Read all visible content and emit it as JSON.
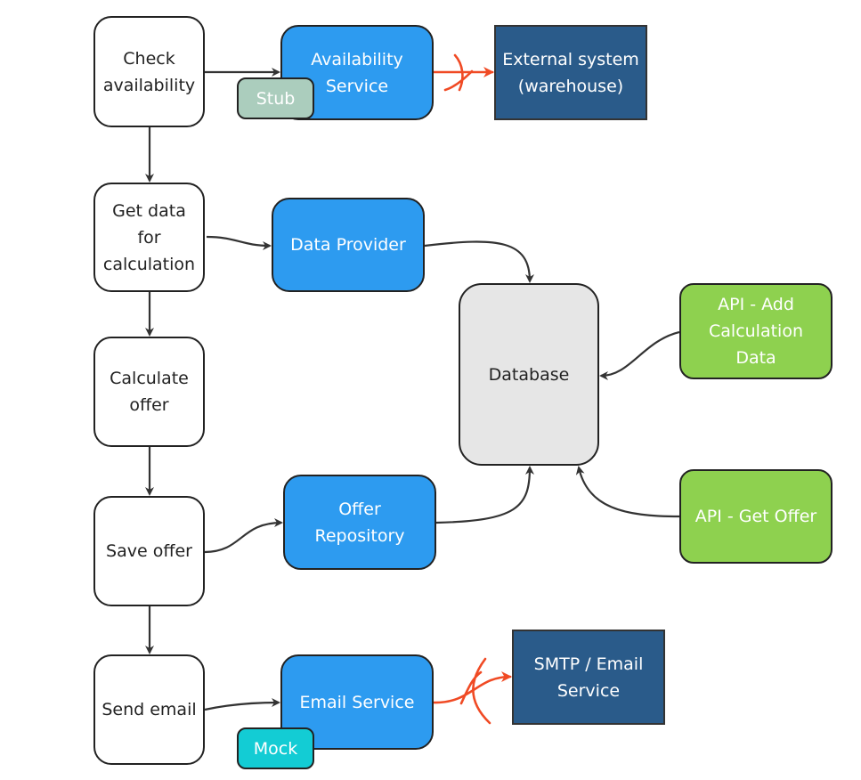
{
  "colors": {
    "service": "#2d9bf0",
    "external": "#2a5b8a",
    "database": "#e6e6e6",
    "api": "#8ed14f",
    "stub": "#abcdbd",
    "mock": "#13ccd4",
    "edge": "#333333",
    "blocked_edge": "#f04a24"
  },
  "nodes": {
    "check_availability": [
      "Check",
      "availability"
    ],
    "availability_service": [
      "Availability",
      "Service"
    ],
    "stub": [
      "Stub"
    ],
    "external_warehouse": [
      "External system",
      "(warehouse)"
    ],
    "get_data": [
      "Get data",
      "for",
      "calculation"
    ],
    "data_provider": [
      "Data Provider"
    ],
    "database": [
      "Database"
    ],
    "api_add": [
      "API - Add",
      "Calculation",
      "Data"
    ],
    "calculate_offer": [
      "Calculate",
      "offer"
    ],
    "save_offer": [
      "Save offer"
    ],
    "offer_repository": [
      "Offer",
      "Repository"
    ],
    "api_get_offer": [
      "API - Get Offer"
    ],
    "send_email": [
      "Send email"
    ],
    "email_service": [
      "Email Service"
    ],
    "mock": [
      "Mock"
    ],
    "smtp": [
      "SMTP / Email",
      "Service"
    ]
  },
  "edges": [
    {
      "from": "check_availability",
      "to": "availability_service"
    },
    {
      "from": "availability_service",
      "to": "external_warehouse",
      "blocked": true
    },
    {
      "from": "check_availability",
      "to": "get_data"
    },
    {
      "from": "get_data",
      "to": "data_provider"
    },
    {
      "from": "data_provider",
      "to": "database"
    },
    {
      "from": "api_add",
      "to": "database"
    },
    {
      "from": "get_data",
      "to": "calculate_offer"
    },
    {
      "from": "calculate_offer",
      "to": "save_offer"
    },
    {
      "from": "save_offer",
      "to": "offer_repository"
    },
    {
      "from": "offer_repository",
      "to": "database"
    },
    {
      "from": "api_get_offer",
      "to": "database"
    },
    {
      "from": "save_offer",
      "to": "send_email"
    },
    {
      "from": "send_email",
      "to": "email_service"
    },
    {
      "from": "email_service",
      "to": "smtp",
      "blocked": true
    }
  ]
}
